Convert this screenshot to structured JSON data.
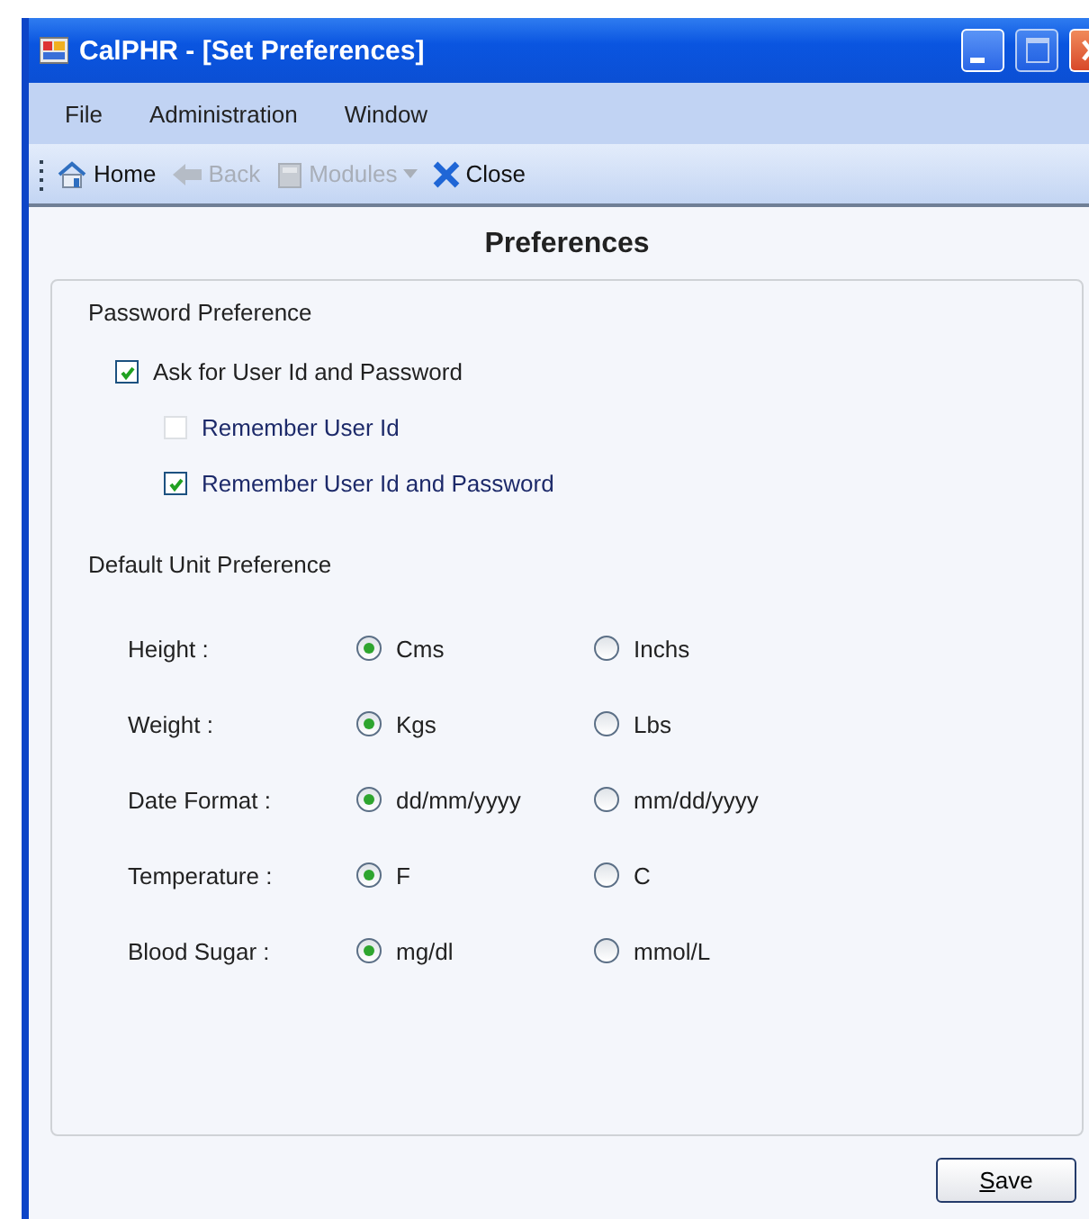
{
  "window": {
    "title": "CalPHR - [Set Preferences]"
  },
  "menu": [
    "File",
    "Administration",
    "Window"
  ],
  "toolbar": [
    {
      "kind": "home",
      "label": "Home",
      "disabled": false
    },
    {
      "kind": "back",
      "label": "Back",
      "disabled": true
    },
    {
      "kind": "modules",
      "label": "Modules",
      "disabled": true
    },
    {
      "kind": "close",
      "label": "Close",
      "disabled": false
    }
  ],
  "heading": "Preferences",
  "password_group": {
    "title": "Password Preference",
    "options": [
      {
        "label": "Ask for User Id and Password",
        "checked": true,
        "children": [
          {
            "label": "Remember User Id",
            "checked": false
          },
          {
            "label": "Remember User Id and Password",
            "checked": true
          }
        ]
      }
    ]
  },
  "unit_group": {
    "title": "Default Unit Preference",
    "rows": [
      {
        "label": "Height :",
        "options": [
          {
            "label": "Cms",
            "selected": true
          },
          {
            "label": "Inchs",
            "selected": false
          }
        ]
      },
      {
        "label": "Weight :",
        "options": [
          {
            "label": "Kgs",
            "selected": true
          },
          {
            "label": "Lbs",
            "selected": false
          }
        ]
      },
      {
        "label": "Date Format :",
        "options": [
          {
            "label": "dd/mm/yyyy",
            "selected": true
          },
          {
            "label": "mm/dd/yyyy",
            "selected": false
          }
        ]
      },
      {
        "label": "Temperature :",
        "options": [
          {
            "label": "F",
            "selected": true
          },
          {
            "label": "C",
            "selected": false
          }
        ]
      },
      {
        "label": "Blood Sugar :",
        "options": [
          {
            "label": "mg/dl",
            "selected": true
          },
          {
            "label": "mmol/L",
            "selected": false
          }
        ]
      }
    ]
  },
  "save_button": "Save"
}
